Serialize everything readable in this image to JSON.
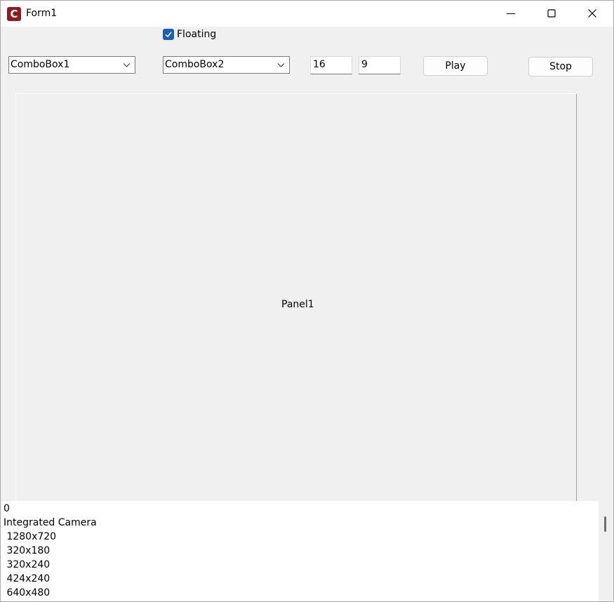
{
  "window": {
    "title": "Form1",
    "app_icon_letter": "C"
  },
  "toolbar": {
    "floating": {
      "label": "Floating",
      "checked": true
    },
    "combo1": {
      "value": "ComboBox1"
    },
    "combo2": {
      "value": "ComboBox2"
    },
    "edit1": {
      "value": "16"
    },
    "edit2": {
      "value": "9"
    },
    "play_label": "Play",
    "stop_label": "Stop"
  },
  "panel": {
    "label": "Panel1"
  },
  "memo": {
    "lines": [
      "0",
      "Integrated Camera",
      " 1280x720",
      " 320x180",
      " 320x240",
      " 424x240",
      " 640x480"
    ]
  },
  "colors": {
    "accent": "#1a5fb4",
    "app_icon": "#8b1e1e"
  },
  "icons": {
    "app": "app-icon",
    "minimize": "minimize-icon",
    "maximize": "maximize-icon",
    "close": "close-icon",
    "chevron": "chevron-down-icon",
    "check": "check-icon"
  }
}
